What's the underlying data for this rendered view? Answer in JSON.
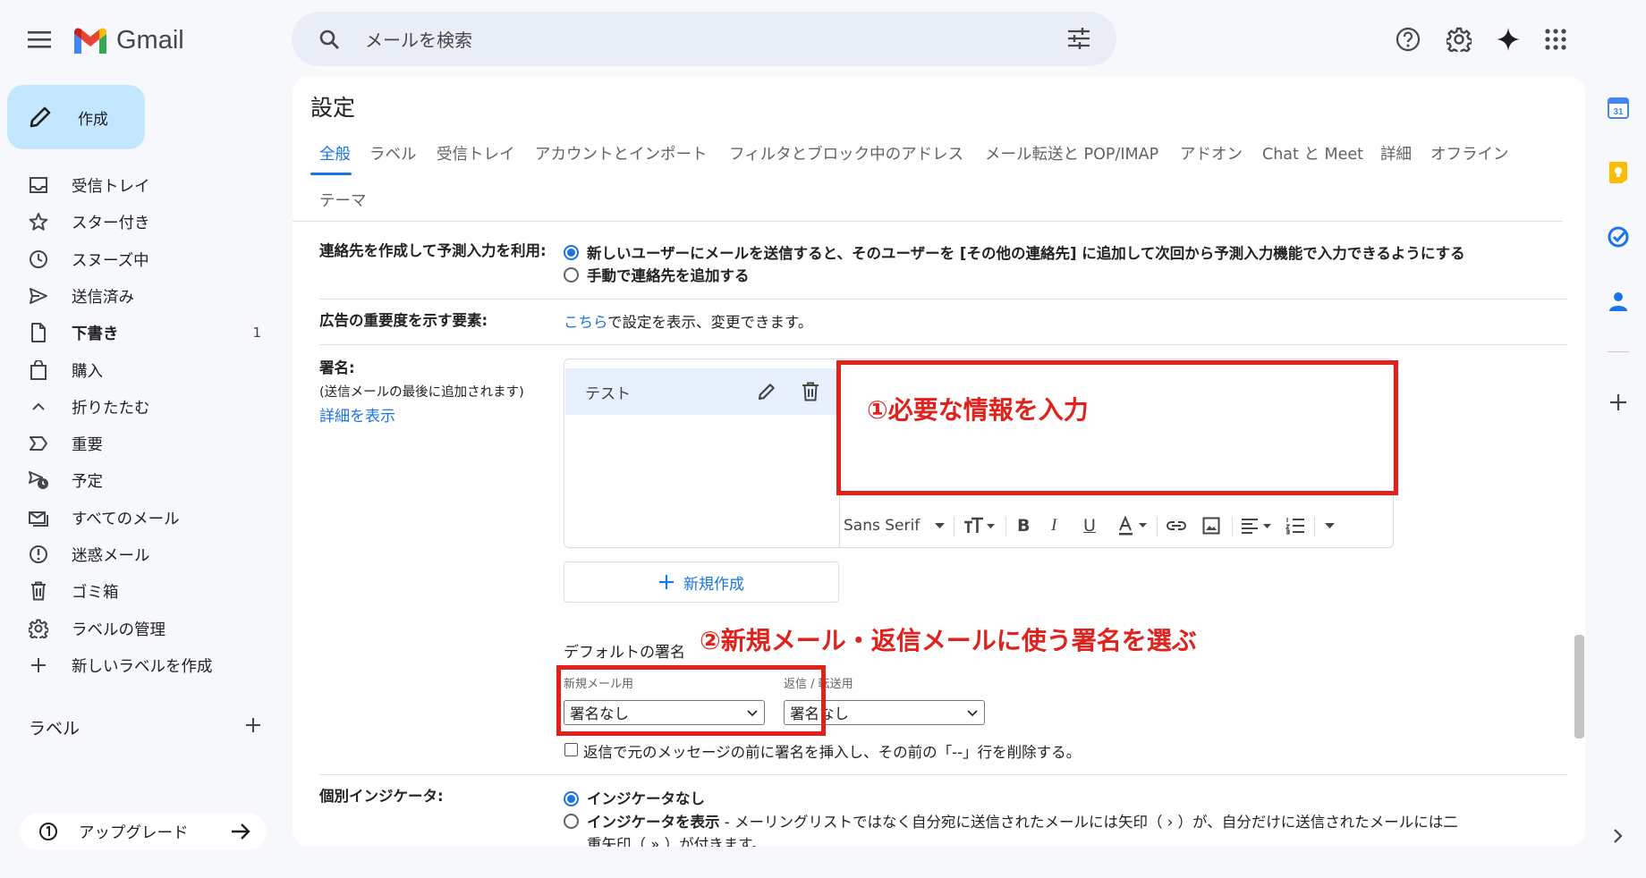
{
  "header": {
    "app_name": "Gmail",
    "search_placeholder": "メールを検索"
  },
  "sidebar": {
    "compose_label": "作成",
    "items": [
      {
        "label": "受信トレイ",
        "icon": "inbox-icon"
      },
      {
        "label": "スター付き",
        "icon": "star-icon"
      },
      {
        "label": "スヌーズ中",
        "icon": "clock-icon"
      },
      {
        "label": "送信済み",
        "icon": "send-icon"
      },
      {
        "label": "下書き",
        "icon": "draft-icon",
        "count": "1"
      },
      {
        "label": "購入",
        "icon": "shopping-bag-icon"
      },
      {
        "label": "折りたたむ",
        "icon": "chevron-up-icon"
      },
      {
        "label": "重要",
        "icon": "important-icon"
      },
      {
        "label": "予定",
        "icon": "scheduled-icon"
      },
      {
        "label": "すべてのメール",
        "icon": "all-mail-icon"
      },
      {
        "label": "迷惑メール",
        "icon": "spam-icon"
      },
      {
        "label": "ゴミ箱",
        "icon": "trash-icon"
      },
      {
        "label": "ラベルの管理",
        "icon": "gear-icon"
      },
      {
        "label": "新しいラベルを作成",
        "icon": "plus-icon"
      }
    ],
    "labels_heading": "ラベル",
    "upgrade_label": "アップグレード"
  },
  "settings": {
    "title": "設定",
    "tabs": [
      "全般",
      "ラベル",
      "受信トレイ",
      "アカウントとインポート",
      "フィルタとブロック中のアドレス",
      "メール転送と POP/IMAP",
      "アドオン",
      "Chat と Meet",
      "詳細",
      "オフライン",
      "テーマ"
    ],
    "active_tab": "全般",
    "contacts": {
      "label": "連絡先を作成して予測入力を利用:",
      "option1": "新しいユーザーにメールを送信すると、そのユーザーを [その他の連絡先] に追加して次回から予測入力機能で入力できるようにする",
      "option2": "手動で連絡先を追加する",
      "selected": "option1"
    },
    "ads": {
      "label": "広告の重要度を示す要素:",
      "link": "こちら",
      "text": "で設定を表示、変更できます。"
    },
    "signature": {
      "label": "署名:",
      "sublabel": "(送信メールの最後に追加されます)",
      "details_link": "詳細を表示",
      "item_name": "テスト",
      "font": "Sans Serif",
      "new_button": "新規作成",
      "default_heading": "デフォルトの署名",
      "new_mail_label": "新規メール用",
      "new_mail_value": "署名なし",
      "reply_label": "返信 / 転送用",
      "reply_value": "署名なし",
      "insert_before_text": "返信で元のメッセージの前に署名を挿入し、その前の「--」行を削除する。",
      "insert_before_checked": false
    },
    "indicators": {
      "label": "個別インジケータ:",
      "option1": "インジケータなし",
      "option2_bold": "インジケータを表示",
      "option2_rest": " - メーリングリストではなく自分宛に送信されたメールには矢印（ › ）が、自分だけに送信されたメールには二",
      "option2_cont": "重矢印（ » ）が付きます。",
      "selected": "option1"
    }
  },
  "annotations": {
    "step1": "①必要な情報を入力",
    "step2": "②新規メール・返信メールに使う署名を選ぶ",
    "color": "#e0221c"
  },
  "colors": {
    "accent": "#1a73e8",
    "compose_bg": "#c2e7ff"
  }
}
